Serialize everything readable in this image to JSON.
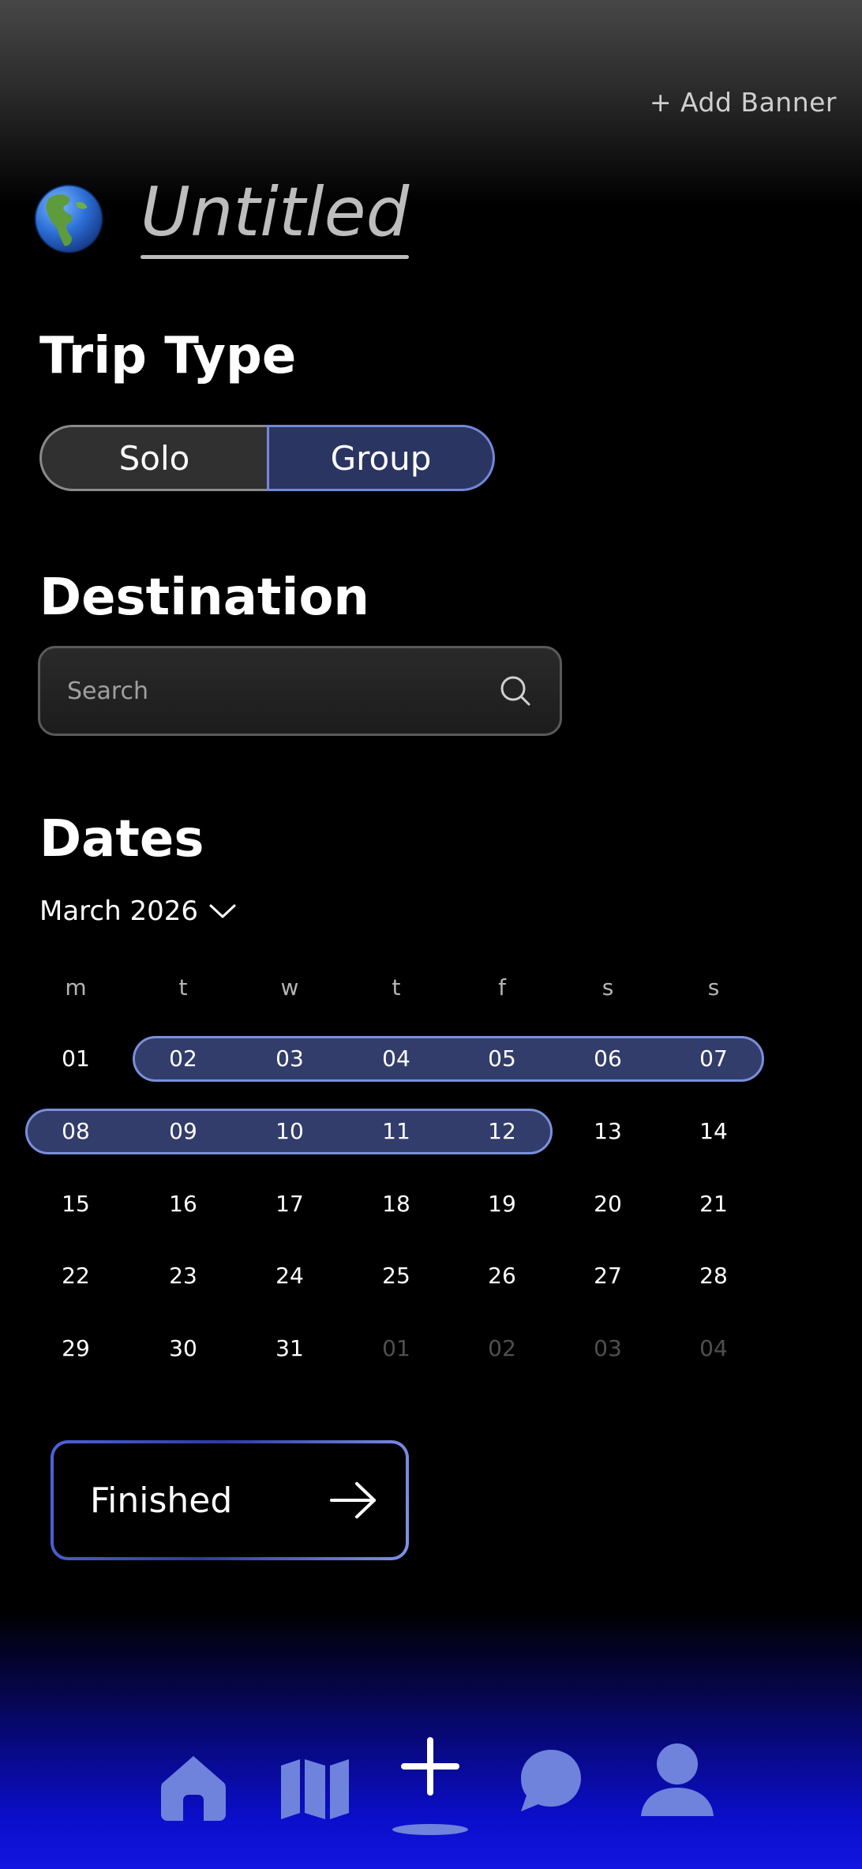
{
  "header": {
    "add_banner_label": "+ Add Banner"
  },
  "trip": {
    "title": "Untitled",
    "icon": "globe-americas-icon"
  },
  "trip_type": {
    "heading": "Trip Type",
    "options": [
      "Solo",
      "Group"
    ],
    "selected": "Group"
  },
  "destination": {
    "heading": "Destination",
    "placeholder": "Search"
  },
  "dates": {
    "heading": "Dates",
    "month_label": "March 2026",
    "weekdays": [
      "m",
      "t",
      "w",
      "t",
      "f",
      "s",
      "s"
    ],
    "weeks": [
      [
        "01",
        "02",
        "03",
        "04",
        "05",
        "06",
        "07"
      ],
      [
        "08",
        "09",
        "10",
        "11",
        "12",
        "13",
        "14"
      ],
      [
        "15",
        "16",
        "17",
        "18",
        "19",
        "20",
        "21"
      ],
      [
        "22",
        "23",
        "24",
        "25",
        "26",
        "27",
        "28"
      ],
      [
        "29",
        "30",
        "31",
        "01",
        "02",
        "03",
        "04"
      ]
    ],
    "selected_range": [
      "02",
      "12"
    ]
  },
  "finish": {
    "label": "Finished"
  },
  "bottom_nav": {
    "items": [
      "home-icon",
      "map-icon",
      "add-icon",
      "chat-icon",
      "profile-icon"
    ],
    "active": "add-icon"
  },
  "colors": {
    "accent": "#7288d8",
    "selected_fill": "#333d6b",
    "nav_icon": "#6f82dc"
  }
}
